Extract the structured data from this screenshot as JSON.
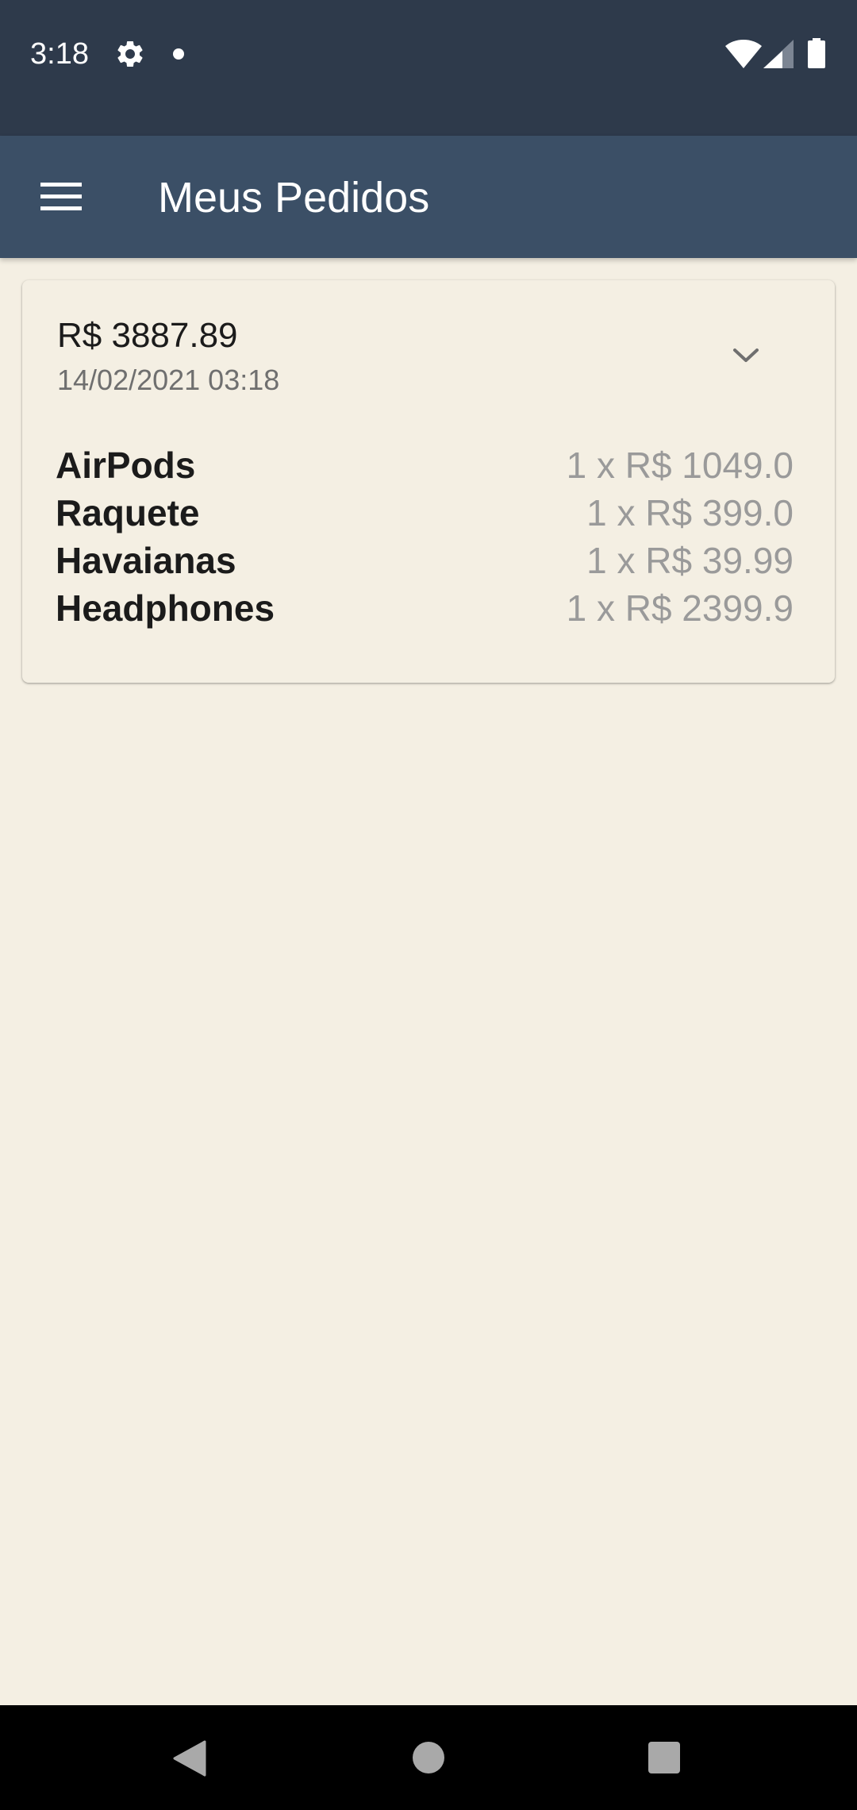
{
  "status_bar": {
    "time": "3:18",
    "icons": [
      "gear-icon",
      "notification-dot-icon",
      "wifi-icon",
      "signal-icon",
      "battery-icon"
    ]
  },
  "app_bar": {
    "title": "Meus Pedidos",
    "menu_icon": "hamburger-menu-icon"
  },
  "order": {
    "total": "R$ 3887.89",
    "date": "14/02/2021 03:18",
    "expand_icon": "chevron-down-icon",
    "items": [
      {
        "name": "AirPods",
        "price": "1 x R$ 1049.0"
      },
      {
        "name": "Raquete",
        "price": "1 x R$ 399.0"
      },
      {
        "name": "Havaianas",
        "price": "1 x R$ 39.99"
      },
      {
        "name": "Headphones",
        "price": "1 x R$ 2399.9"
      }
    ]
  },
  "nav_bar": {
    "icons": [
      "back-icon",
      "home-icon",
      "recents-icon"
    ]
  },
  "colors": {
    "status_bar": "#2e3a4b",
    "app_bar": "#3b4f66",
    "background": "#f4efe3",
    "item_price": "#9a9a9a"
  }
}
